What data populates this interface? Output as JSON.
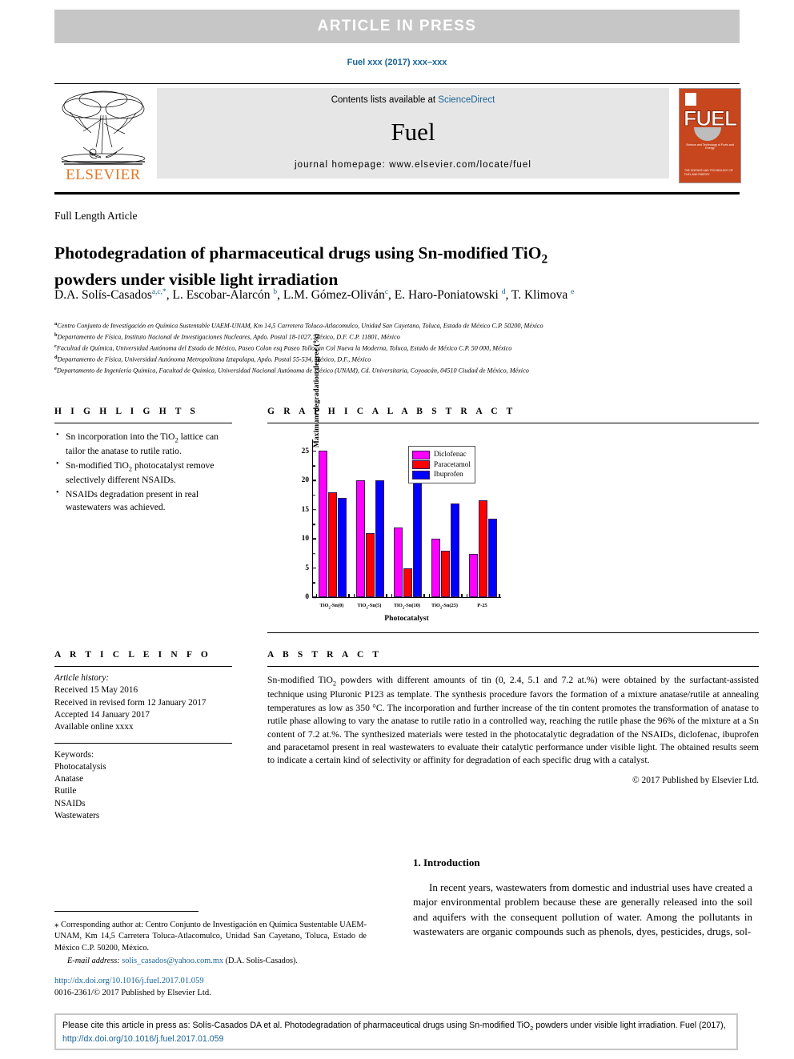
{
  "banner": {
    "text": "ARTICLE  IN  PRESS"
  },
  "journal_ref": "Fuel xxx (2017) xxx–xxx",
  "masthead": {
    "contents_prefix": "Contents lists available at ",
    "sciencedirect": "ScienceDirect",
    "journal_title": "Fuel",
    "homepage": "journal homepage: www.elsevier.com/locate/fuel",
    "publisher": "ELSEVIER",
    "cover": {
      "word": "FUEL",
      "subtitle": "Science and Technology of Fuels and Energy",
      "footer": "THE SCIENCE AND TECHNOLOGY\nOF FUEL AND ENERGY"
    },
    "accent_orange": "#e87722",
    "cover_bg": "#c8461e"
  },
  "article": {
    "type": "Full Length Article",
    "title_line1": "Photodegradation of pharmaceutical drugs using Sn-modified TiO",
    "title_sub": "2",
    "title_line2": "powders under visible light irradiation",
    "authors": [
      {
        "name": "D.A. Solís-Casados",
        "sup": "a,c,",
        "star": "*"
      },
      {
        "name": "L. Escobar-Alarcón",
        "sup": "b",
        "star": ""
      },
      {
        "name": "L.M. Gómez-Oliván",
        "sup": "c",
        "star": ""
      },
      {
        "name": "E. Haro-Poniatowski",
        "sup": "d",
        "star": ""
      },
      {
        "name": "T. Klimova",
        "sup": "e",
        "star": ""
      }
    ],
    "affiliations": [
      {
        "marker": "a",
        "text": "Centro Conjunto de Investigación en Química Sustentable UAEM-UNAM, Km 14,5 Carretera Toluca-Atlacomulco, Unidad San Cayetano, Toluca, Estado de México C.P. 50200, México"
      },
      {
        "marker": "b",
        "text": "Departamento de Física, Instituto Nacional de Investigaciones Nucleares, Apdo. Postal 18-1027, México, D.F. C.P. 11801, México"
      },
      {
        "marker": "c",
        "text": "Facultad de Química, Universidad Autónoma del Estado de México, Paseo Colon esq Paseo Tollocan Col Nueva la Moderna, Toluca, Estado de México C.P. 50 000, México"
      },
      {
        "marker": "d",
        "text": "Departamento de Física, Universidad Autónoma Metropolitana Iztapalapa, Apdo. Postal 55-534, México, D.F., México"
      },
      {
        "marker": "e",
        "text": "Departamento de Ingeniería Química, Facultad de Química, Universidad Nacional Autónoma de México (UNAM), Cd. Universitaria, Coyoacán, 04510 Ciudad de México, México"
      }
    ]
  },
  "highlights": {
    "heading": "H I G H L I G H T S",
    "items": [
      "Sn incorporation into the TiO2 lattice can tailor the anatase to rutile ratio.",
      "Sn-modified TiO2 photocatalyst remove selectively different NSAIDs.",
      "NSAIDs degradation present in real wastewaters was achieved."
    ]
  },
  "graphical_abstract": {
    "heading": "G R A P H I C A L   A B S T R A C T"
  },
  "chart_data": {
    "type": "bar",
    "title": "",
    "xlabel": "Photocatalyst",
    "ylabel": "Maximum degradation degree (%)",
    "ylim": [
      0,
      27
    ],
    "yticks": [
      0,
      5,
      10,
      15,
      20,
      25
    ],
    "grid": false,
    "legend_position": "top-right",
    "categories": [
      "TiO2-Sn(0)",
      "TiO2-Sn(5)",
      "TiO2-Sn(10)",
      "TiO2-Sn(25)",
      "P-25"
    ],
    "series": [
      {
        "name": "Diclofenac",
        "color": "#FF00FF",
        "values": [
          25.1,
          20.1,
          12.0,
          10.0,
          7.5
        ]
      },
      {
        "name": "Paracetamol",
        "color": "#FF0000",
        "values": [
          18.0,
          11.0,
          5.0,
          8.0,
          16.6
        ]
      },
      {
        "name": "Ibuprofen",
        "color": "#0000FF",
        "values": [
          17.0,
          20.1,
          25.1,
          16.1,
          13.5
        ]
      }
    ]
  },
  "article_info": {
    "heading": "A R T I C L E   I N F O",
    "history_label": "Article history:",
    "history": [
      "Received 15 May 2016",
      "Received in revised form 12 January 2017",
      "Accepted 14 January 2017",
      "Available online xxxx"
    ],
    "keywords_label": "Keywords:",
    "keywords": [
      "Photocatalysis",
      "Anatase",
      "Rutile",
      "NSAIDs",
      "Wastewaters"
    ]
  },
  "abstract": {
    "heading": "A B S T R A C T",
    "text": "Sn-modified TiO2 powders with different amounts of tin (0, 2.4, 5.1 and 7.2 at.%) were obtained by the surfactant-assisted technique using Pluronic P123 as template. The synthesis procedure favors the formation of a mixture anatase/rutile at annealing temperatures as low as 350 °C. The incorporation and further increase of the tin content promotes the transformation of anatase to rutile phase allowing to vary the anatase to rutile ratio in a controlled way, reaching the rutile phase the 96% of the mixture at a Sn content of 7.2 at.%. The synthesized materials were tested in the photocatalytic degradation of the NSAIDs, diclofenac, ibuprofen and paracetamol present in real wastewaters to evaluate their catalytic performance under visible light. The obtained results seem to indicate a certain kind of selectivity or affinity for degradation of each specific drug with a catalyst.",
    "copyright": "© 2017 Published by Elsevier Ltd."
  },
  "introduction": {
    "heading": "1. Introduction",
    "paragraph": "In recent years, wastewaters from domestic and industrial uses have created a major environmental problem because these are generally released into the soil and aquifers with the consequent pollution of water. Among the pollutants in wastewaters are organic compounds such as phenols, dyes, pesticides, drugs, sol-"
  },
  "footnote": {
    "corresponding": "Corresponding author at: Centro Conjunto de Investigación en Química Sustentable UAEM-UNAM, Km 14,5 Carretera Toluca-Atlacomulco, Unidad San Cayetano, Toluca, Estado de México C.P. 50200, México.",
    "email_label": "E-mail address:",
    "email": "solis_casados@yahoo.com.mx",
    "email_owner": "(D.A. Solís-Casados).",
    "doi": "http://dx.doi.org/10.1016/j.fuel.2017.01.059",
    "issn_line": "0016-2361/© 2017 Published by Elsevier Ltd."
  },
  "cite_box": {
    "text_before": "Please cite this article in press as: Solís-Casados DA et al. Photodegradation of pharmaceutical drugs using Sn-modified TiO",
    "sub": "2",
    "text_mid": " powders under visible light irradiation. Fuel (2017), ",
    "link": "http://dx.doi.org/10.1016/j.fuel.2017.01.059"
  },
  "colors": {
    "link": "#1a6496",
    "band": "#c6c6c6",
    "masthead_bg": "#e6e6e6"
  }
}
